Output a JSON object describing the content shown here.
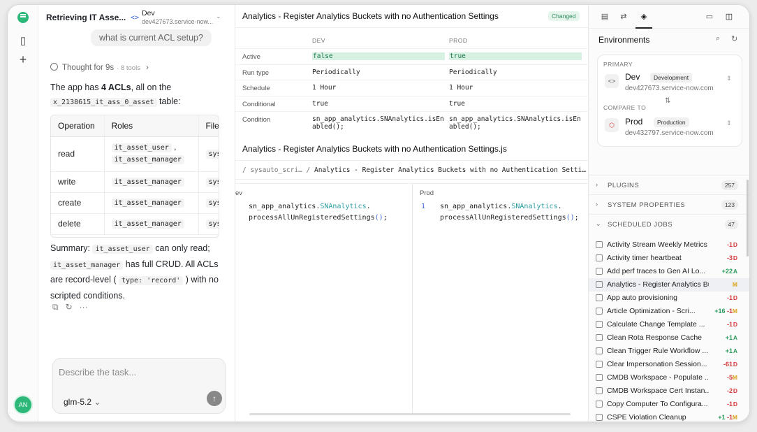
{
  "chat": {
    "title": "Retrieving IT Asse...",
    "env": {
      "code_icon": "<>",
      "name": "Dev",
      "host": "dev427673.service-now...",
      "chevron": "⌄"
    },
    "user_message": "what is current ACL setup?",
    "thought": {
      "label": "Thought for 9s",
      "tools": "· 8 tools",
      "arrow": "›"
    },
    "intro_prefix": "The app has ",
    "intro_bold": "4 ACLs",
    "intro_suffix": ", all on the",
    "table_name": "x_2138615_it_ass_0_asset",
    "table_suffix": " table:",
    "acl_headers": [
      "Operation",
      "Roles",
      "File"
    ],
    "acl_rows": [
      {
        "op": "read",
        "roles": [
          "it_asset_user",
          "it_asset_manager"
        ],
        "roles_sep": ",",
        "file": "sys"
      },
      {
        "op": "write",
        "roles": [
          "it_asset_manager"
        ],
        "file": "sys"
      },
      {
        "op": "create",
        "roles": [
          "it_asset_manager"
        ],
        "file": "sys"
      },
      {
        "op": "delete",
        "roles": [
          "it_asset_manager"
        ],
        "file": "sys"
      }
    ],
    "summary": {
      "p1": "Summary: ",
      "c1": "it_asset_user",
      "p2": " can only read; ",
      "c2": "it_asset_manager",
      "p3": " has full CRUD. All ACLs are record-level ( ",
      "c3": "type: 'record'",
      "p4": " ) with no scripted conditions."
    },
    "actions": {
      "copy": "⧉",
      "retry": "↻",
      "more": "···"
    },
    "composer": {
      "placeholder": "Describe the task...",
      "model": "glm-5.2",
      "model_chevron": "⌄",
      "send": "↑"
    }
  },
  "rail": {
    "avatar": "AN",
    "book_icon": "▯",
    "plus_icon": "+"
  },
  "diff": {
    "title": "Analytics - Register Analytics Buckets with no Authentication Settings",
    "badge": "Changed",
    "col_dev": "DEV",
    "col_prod": "PROD",
    "rows": [
      {
        "label": "Active",
        "dev": "false",
        "prod": "true",
        "changed": true
      },
      {
        "label": "Run type",
        "dev": "Periodically",
        "prod": "Periodically",
        "changed": false
      },
      {
        "label": "Schedule",
        "dev": "1 Hour",
        "prod": "1 Hour",
        "changed": false
      },
      {
        "label": "Conditional",
        "dev": "true",
        "prod": "true",
        "changed": false
      },
      {
        "label": "Condition",
        "dev": "sn_app_analytics.SNAnalytics.isEnabled();",
        "prod": "sn_app_analytics.SNAnalytics.isEnabled();",
        "changed": false
      }
    ],
    "file_title": "Analytics - Register Analytics Buckets with no Authentication Settings.js",
    "path": {
      "sep1": "/ ",
      "seg1": "sysauto_scri…",
      "sep2": " / ",
      "seg2": "Analytics - Register Analytics Buckets with no Authentication Setti…"
    },
    "left_label": "ev",
    "right_label": "Prod",
    "line_no": "1",
    "code": {
      "a": "sn_app_analytics.",
      "cls": "SNAnalytics",
      "dot": ".",
      "b": "processAllUnRegisteredSettings",
      "p": "()",
      "semi": ";"
    }
  },
  "side": {
    "environments_title": "Environments",
    "primary_label": "PRIMARY",
    "compare_label": "COMPARE TO",
    "primary": {
      "icon": "<>",
      "name": "Dev",
      "badge": "Development",
      "host": "dev427673.service-now.com"
    },
    "compare": {
      "icon": "⬡",
      "name": "Prod",
      "badge": "Production",
      "host": "dev432797.service-now.com"
    },
    "swap_icon": "⇅",
    "sort_icon": "⇕",
    "groups": [
      {
        "label": "PLUGINS",
        "count": "257",
        "expanded": false
      },
      {
        "label": "SYSTEM PROPERTIES",
        "count": "123",
        "expanded": false
      },
      {
        "label": "SCHEDULED JOBS",
        "count": "47",
        "expanded": true
      }
    ],
    "jobs": [
      {
        "name": "Activity Stream Weekly Metrics",
        "delta": "-1",
        "kind": "D"
      },
      {
        "name": "Activity timer heartbeat",
        "delta": "-3",
        "kind": "D"
      },
      {
        "name": "Add perf traces to Gen AI Lo...",
        "delta": "+22",
        "kind": "A"
      },
      {
        "name": "Analytics - Register Analytics Bu...",
        "delta": "",
        "kind": "M",
        "selected": true
      },
      {
        "name": "App auto provisioning",
        "delta": "-1",
        "kind": "D"
      },
      {
        "name": "Article Optimization - Scri...",
        "delta": "+16 -1",
        "kind": "M"
      },
      {
        "name": "Calculate Change Template ...",
        "delta": "-1",
        "kind": "D"
      },
      {
        "name": "Clean Rota Response Cache",
        "delta": "+1",
        "kind": "A"
      },
      {
        "name": "Clean Trigger Rule Workflow ...",
        "delta": "+1",
        "kind": "A"
      },
      {
        "name": "Clear Impersonation Session...",
        "delta": "-61",
        "kind": "D"
      },
      {
        "name": "CMDB Workspace - Populate ...",
        "delta": "-5",
        "kind": "M"
      },
      {
        "name": "CMDB Workspace Cert Instan...",
        "delta": "-2",
        "kind": "D"
      },
      {
        "name": "Copy Computer To Configura...",
        "delta": "-1",
        "kind": "D"
      },
      {
        "name": "CSPE Violation Cleanup",
        "delta": "+1 -1",
        "kind": "M"
      }
    ]
  }
}
